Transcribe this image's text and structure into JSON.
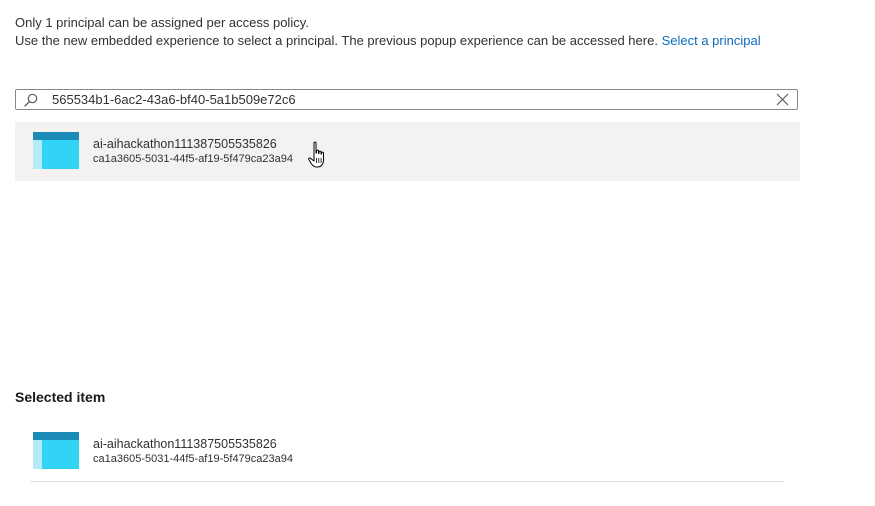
{
  "info": {
    "line1": "Only 1 principal can be assigned per access policy.",
    "line2": "Use the new embedded experience to select a principal. The previous popup experience can be accessed here.",
    "link": "Select a principal"
  },
  "search": {
    "value": "565534b1-6ac2-43a6-bf40-5a1b509e72c6",
    "icon": "search-icon",
    "clear_icon": "close-icon"
  },
  "results": [
    {
      "name": "ai-aihackathon111387505535826",
      "id": "ca1a3605-5031-44f5-af19-5f479ca23a94",
      "icon": "app-registration-icon"
    }
  ],
  "selected": {
    "title": "Selected item",
    "items": [
      {
        "name": "ai-aihackathon111387505535826",
        "id": "ca1a3605-5031-44f5-af19-5f479ca23a94",
        "icon": "app-registration-icon"
      }
    ]
  },
  "colors": {
    "link": "#0f6cbd",
    "highlight": "#f3f2f1",
    "icon_dark": "#1c8bb7",
    "icon_light": "#32d4f5",
    "icon_pale": "#b3ecf8"
  }
}
